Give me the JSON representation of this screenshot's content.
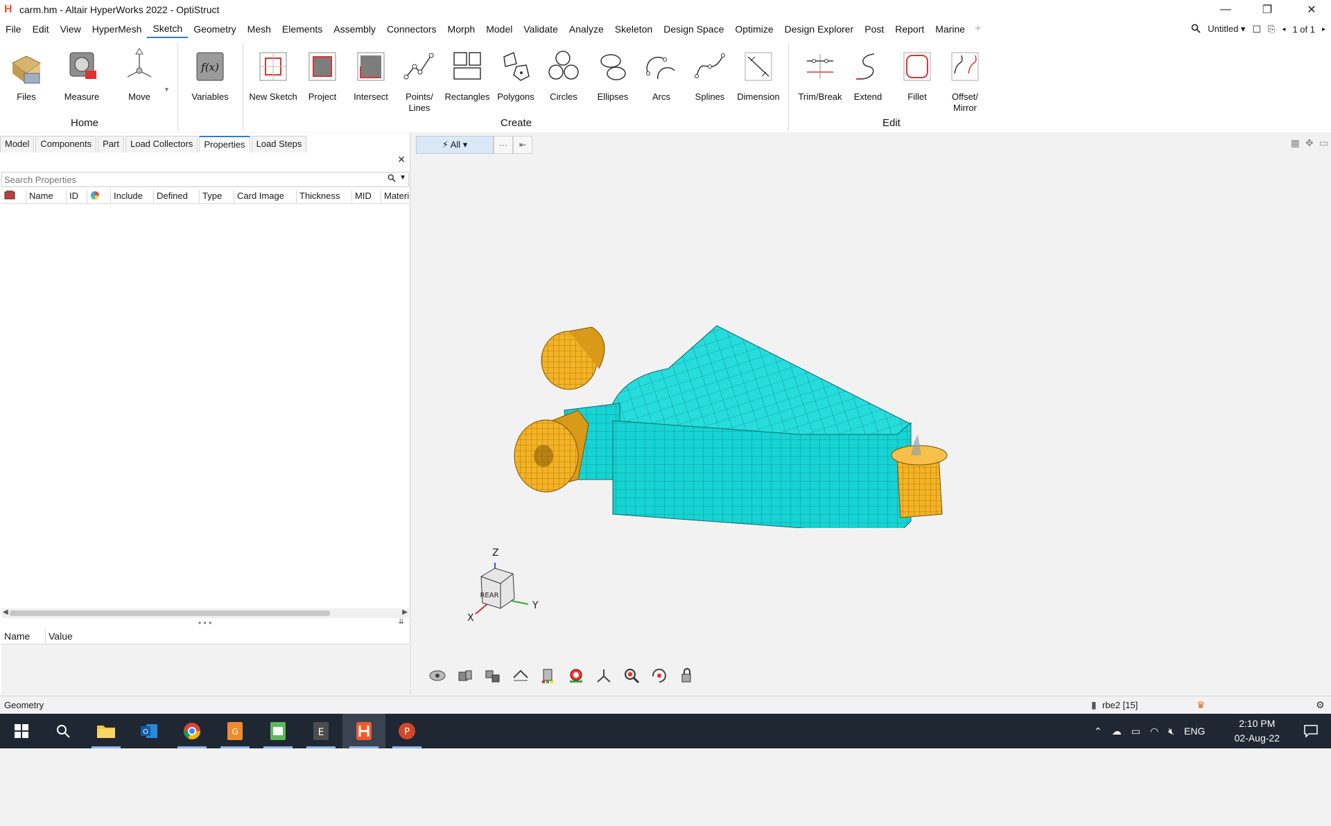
{
  "window": {
    "title": "carm.hm - Altair HyperWorks 2022 - OptiStruct",
    "app_logo": "H",
    "minimize": "—",
    "restore": "❐",
    "close": "✕"
  },
  "menubar": {
    "items": [
      "File",
      "Edit",
      "View",
      "HyperMesh",
      "Sketch",
      "Geometry",
      "Mesh",
      "Elements",
      "Assembly",
      "Connectors",
      "Morph",
      "Model",
      "Validate",
      "Analyze",
      "Skeleton",
      "Design Space",
      "Optimize",
      "Design Explorer",
      "Post",
      "Report",
      "Marine"
    ],
    "active": "Sketch",
    "plus": "+",
    "session_name": "Untitled",
    "page_indicator": "1 of 1"
  },
  "ribbon": {
    "home": {
      "label": "Home",
      "buttons": [
        "Files",
        "Measure",
        "Move"
      ]
    },
    "variables": {
      "label": "Variables"
    },
    "create": {
      "label": "Create",
      "buttons": [
        "New Sketch",
        "Project",
        "Intersect",
        "Points/ Lines",
        "Rectangles",
        "Polygons",
        "Circles",
        "Ellipses",
        "Arcs",
        "Splines",
        "Dimension"
      ]
    },
    "edit": {
      "label": "Edit",
      "buttons": [
        "Trim/Break",
        "Extend",
        "Fillet",
        "Offset/ Mirror"
      ]
    }
  },
  "browser": {
    "tabs": [
      "Model",
      "Components",
      "Part",
      "Load Collectors",
      "Properties",
      "Load Steps"
    ],
    "active_tab": "Properties",
    "close": "✕",
    "search_placeholder": "Search Properties",
    "columns": [
      "",
      "Name",
      "ID",
      "",
      "Include",
      "Defined",
      "Type",
      "Card Image",
      "Thickness",
      "MID",
      "Materi"
    ],
    "rows": [],
    "splitter": "• • •",
    "property_columns": [
      "Name",
      "Value"
    ]
  },
  "viewport": {
    "selector_label": "⚡ All ▾",
    "selector_more": "···",
    "selector_end": "⇤",
    "triad": {
      "z": "Z",
      "y": "Y",
      "x": "X",
      "cube_face": "REAR"
    },
    "colors": {
      "mesh_body": "#17d3d3",
      "mesh_lines": "#0a6a6a",
      "bushing": "#f4b325",
      "bushing_lines": "#7a5200"
    }
  },
  "statusbar": {
    "left": "Geometry",
    "selection": "rbe2 [15]"
  },
  "taskbar": {
    "apps": [
      "start-icon",
      "search-icon",
      "file-explorer-icon",
      "outlook-icon",
      "chrome-icon",
      "pdf-icon",
      "sheets-icon",
      "evernote-icon",
      "hyperworks-icon",
      "powerpoint-icon"
    ],
    "language": "ENG",
    "time": "2:10 PM",
    "date": "02-Aug-22"
  }
}
